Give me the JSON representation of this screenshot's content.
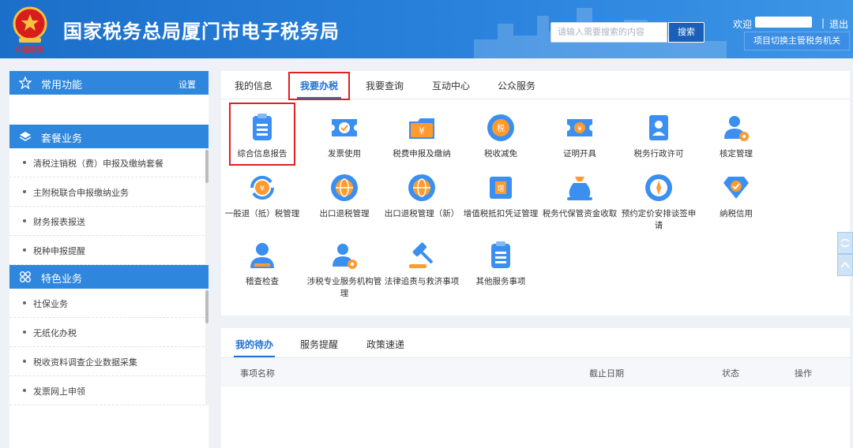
{
  "header": {
    "emblem_caption": "中国税务",
    "title": "国家税务总局厦门市电子税务局",
    "search_placeholder": "请输入需要搜索的内容",
    "search_label": "搜索",
    "welcome": "欢迎",
    "separator": "|",
    "logout": "退出",
    "switch_label": "项目切换主管税务机关"
  },
  "sidebar": {
    "common": {
      "label": "常用功能",
      "setting": "设置",
      "icon": "star-icon"
    },
    "package": {
      "label": "套餐业务",
      "icon": "layers-icon",
      "items": [
        "清税注销税（费）申报及缴纳套餐",
        "主附税联合申报缴纳业务",
        "财务报表报送",
        "税种申报提醒"
      ]
    },
    "special": {
      "label": "特色业务",
      "icon": "grid-icon",
      "items": [
        "社保业务",
        "无纸化办税",
        "税收资料调查企业数据采集",
        "发票网上申领"
      ]
    }
  },
  "main": {
    "tabs": [
      "我的信息",
      "我要办税",
      "我要查询",
      "互动中心",
      "公众服务"
    ],
    "active_tab": "我要办税",
    "services": [
      {
        "name": "综合信息报告",
        "icon": "clipboard-icon"
      },
      {
        "name": "发票使用",
        "icon": "ticket-icon"
      },
      {
        "name": "税费申报及缴纳",
        "icon": "money-folder-icon"
      },
      {
        "name": "税收减免",
        "icon": "tax-coin-icon"
      },
      {
        "name": "证明开具",
        "icon": "yen-ticket-icon"
      },
      {
        "name": "税务行政许可",
        "icon": "id-card-icon"
      },
      {
        "name": "核定管理",
        "icon": "user-gear-icon"
      },
      {
        "name": "一般退（抵）税管理",
        "icon": "yen-refresh-icon"
      },
      {
        "name": "出口退税管理",
        "icon": "globe-icon"
      },
      {
        "name": "出口退税管理（新）",
        "icon": "globe-icon"
      },
      {
        "name": "增值税抵扣凭证管理",
        "icon": "vat-receipt-icon"
      },
      {
        "name": "税务代保管资金收取",
        "icon": "money-bag-icon"
      },
      {
        "name": "预约定价安排谈签申请",
        "icon": "compass-icon"
      },
      {
        "name": "纳税信用",
        "icon": "diamond-check-icon"
      },
      {
        "name": "稽查检查",
        "icon": "user-icon"
      },
      {
        "name": "涉税专业服务机构管理",
        "icon": "user-gear-icon"
      },
      {
        "name": "法律追责与救济事项",
        "icon": "gavel-icon"
      },
      {
        "name": "其他服务事项",
        "icon": "clipboard-icon"
      }
    ]
  },
  "todo": {
    "tabs": [
      "我的待办",
      "服务提醒",
      "政策速递"
    ],
    "columns": [
      "事项名称",
      "截止日期",
      "状态",
      "操作"
    ]
  },
  "colors": {
    "brand": "#2a82dd",
    "accent": "#1f6fd1",
    "highlight": "#e02020",
    "icon_blue": "#3a8ff0",
    "icon_orange": "#ff9a2e"
  }
}
